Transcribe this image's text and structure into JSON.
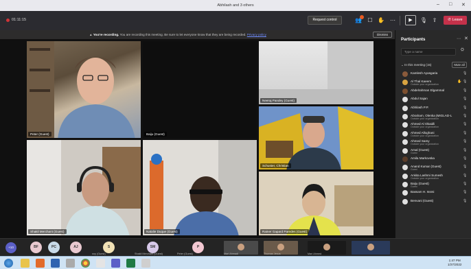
{
  "window": {
    "title": "Abhilash and 3 others",
    "min": "–",
    "max": "□",
    "close": "✕"
  },
  "toolbar": {
    "timer": "01:11:15",
    "request_control": "Request control",
    "leave": "Leave",
    "icons": [
      "participants-icon",
      "chat-icon",
      "reactions-icon",
      "more-icon",
      "camera-icon",
      "mic-icon",
      "share-icon"
    ]
  },
  "recording_banner": {
    "bold": "You're recording.",
    "text": "You are recording this meeting. Be sure to let everyone know that they are being recorded.",
    "link": "Privacy policy",
    "dismiss": "Dismiss"
  },
  "tiles": [
    {
      "name": "Peter (Guest)"
    },
    {
      "name": "Baiju (Guest)"
    },
    {
      "name": "Neeraj Pandey (Guest)"
    },
    {
      "name": "Schuster, Christian"
    },
    {
      "name": "Shakil Merchant (Guest)"
    },
    {
      "name": "Natalie Duque (Guest)"
    },
    {
      "name": "Rainer Gapard Paredes (Guest)"
    }
  ],
  "participants": {
    "header": "Participants",
    "search_placeholder": "Type a name",
    "section": "In this meeting (15)",
    "mute_all": "Mute all",
    "people": [
      {
        "name": "Kamlesh Ayasgaria",
        "sub": "",
        "color": "#8a5a3b"
      },
      {
        "name": "Al Thal Kaeem",
        "sub": "Outside your organization",
        "color": "#d9a441"
      },
      {
        "name": "Abdelrahman Elgammal",
        "sub": "",
        "color": "#7c4f2f"
      },
      {
        "name": "Abdul Sajan",
        "sub": "",
        "color": "#e0e0e0"
      },
      {
        "name": "Abhilash P.P.",
        "sub": "",
        "color": "#e0e0e0"
      },
      {
        "name": "Abraham, Olenka (MIGLAD-L",
        "sub": "Outside your organization",
        "color": "#e0e0e0"
      },
      {
        "name": "Ahmed Al Obaidli",
        "sub": "Outside your organization",
        "color": "#e0e0e0"
      },
      {
        "name": "Ahmed Alloghani",
        "sub": "Outside your organization",
        "color": "#e0e0e0"
      },
      {
        "name": "Ahmed Samy",
        "sub": "Outside your organization",
        "color": "#e0e0e0"
      },
      {
        "name": "Amal (Guest)",
        "sub": "Guest",
        "color": "#e0e0e0"
      },
      {
        "name": "Amila Markovska",
        "sub": "",
        "color": "#5a3d2a"
      },
      {
        "name": "Anand Kumar (Guest)",
        "sub": "Guest",
        "color": "#e0e0e0"
      },
      {
        "name": "Ankita Lashmi Sumesh",
        "sub": "Outside your organization",
        "color": "#e0e0e0"
      },
      {
        "name": "Baiju (Guest)",
        "sub": "Guest",
        "color": "#e0e0e0"
      },
      {
        "name": "Bassam H. Issmi",
        "sub": "",
        "color": "#e0e0e0"
      },
      {
        "name": "Benvani (Guest)",
        "sub": "",
        "color": "#e0e0e0"
      }
    ]
  },
  "gallery": {
    "count": "+10",
    "people": [
      {
        "initials": "BF",
        "label": "",
        "color": "#e9c9d0"
      },
      {
        "initials": "PC",
        "label": "",
        "color": "#c9dbe9"
      },
      {
        "initials": "AJ",
        "label": "",
        "color": "#e9c9d0"
      },
      {
        "initials": "S",
        "label": "sny (Guest)",
        "color": "#f1e1b5"
      },
      {
        "initials": "SM",
        "label": "Shakil Merchant (Guest)",
        "color": "#d7c9e9"
      },
      {
        "initials": "P",
        "label": "Peter (Guest)",
        "color": "#f3c8d2"
      }
    ],
    "thumbs": [
      {
        "label": "Mari Ahmadi"
      },
      {
        "label": "Thomas Jesus"
      },
      {
        "label": "Mari Ahmed"
      },
      {
        "label": ""
      }
    ]
  },
  "taskbar": {
    "time": "1:47 PM",
    "date": "1/27/2022"
  }
}
